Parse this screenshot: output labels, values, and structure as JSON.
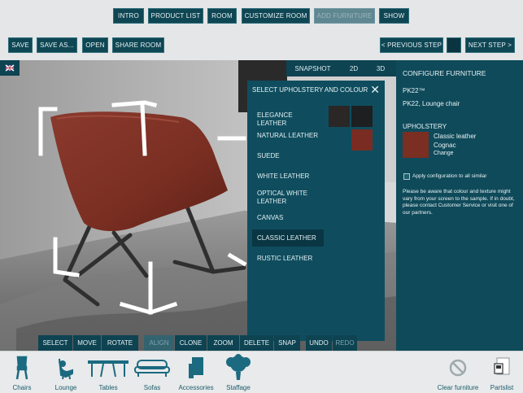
{
  "top_nav": {
    "tabs": [
      {
        "label": "INTRO"
      },
      {
        "label": "PRODUCT LIST"
      },
      {
        "label": "ROOM"
      },
      {
        "label": "CUSTOMIZE ROOM"
      },
      {
        "label": "ADD FURNITURE"
      },
      {
        "label": "SHOW"
      }
    ],
    "active_tab": "ADD FURNITURE"
  },
  "actions": {
    "save": "SAVE",
    "save_as": "SAVE AS...",
    "open": "OPEN",
    "share_room": "SHARE ROOM",
    "previous_step": "< PREVIOUS STEP",
    "next_step": "NEXT STEP >"
  },
  "view_tabs": {
    "snapshot": "SNAPSHOT",
    "2d": "2D",
    "3d": "3D"
  },
  "upholstery_modal": {
    "title": "SELECT UPHOLSTERY AND COLOUR",
    "close": "✕",
    "items": [
      {
        "label": "ELEGANCE LEATHER"
      },
      {
        "label": "NATURAL LEATHER"
      },
      {
        "label": "SUEDE"
      },
      {
        "label": "WHITE LEATHER"
      },
      {
        "label": "OPTICAL WHITE LEATHER"
      },
      {
        "label": "CANVAS"
      },
      {
        "label": "CLASSIC LEATHER"
      },
      {
        "label": "RUSTIC LEATHER"
      }
    ],
    "selected": "CLASSIC LEATHER",
    "swatch_colors": {
      "elegance_1": "#2a2726",
      "elegance_2": "#1d1f21",
      "natural": "#7a2c23"
    }
  },
  "configure": {
    "heading": "CONFIGURE FURNITURE",
    "product_code": "PK22™",
    "product_name": "PK22, Lounge chair",
    "upholstery_heading": "UPHOLSTERY",
    "upholstery_name": "Classic leather",
    "upholstery_colour": "Cognac",
    "change": "Change",
    "apply_label": "Apply configuration to all similar",
    "disclaimer": "Please be aware that colour and texture might vary from your screen to the sample. If in doubt, please contact Customer Service or visit one of our partners.",
    "swatch_color": "#7b2e22"
  },
  "toolbar": {
    "select": "SELECT",
    "move": "MOVE",
    "rotate": "ROTATE",
    "align": "ALIGN",
    "clone": "CLONE",
    "zoom": "ZOOM",
    "delete": "DELETE",
    "snap": "SNAP",
    "undo": "UNDO",
    "redo": "REDO"
  },
  "categories": [
    {
      "label": "Chairs",
      "icon": "chair-icon"
    },
    {
      "label": "Lounge",
      "icon": "lounge-chair-icon"
    },
    {
      "label": "Tables",
      "icon": "table-icon"
    },
    {
      "label": "Sofas",
      "icon": "sofa-icon"
    },
    {
      "label": "Accessories",
      "icon": "accessories-icon"
    },
    {
      "label": "Staffage",
      "icon": "plant-icon"
    }
  ],
  "utility": [
    {
      "label": "Clear furniture",
      "icon": "clear-icon"
    },
    {
      "label": "Partslist",
      "icon": "partslist-icon"
    }
  ],
  "colors": {
    "brand": "#0f4654",
    "panel": "#0f4a5a",
    "accent_text": "#1b5b6b"
  }
}
